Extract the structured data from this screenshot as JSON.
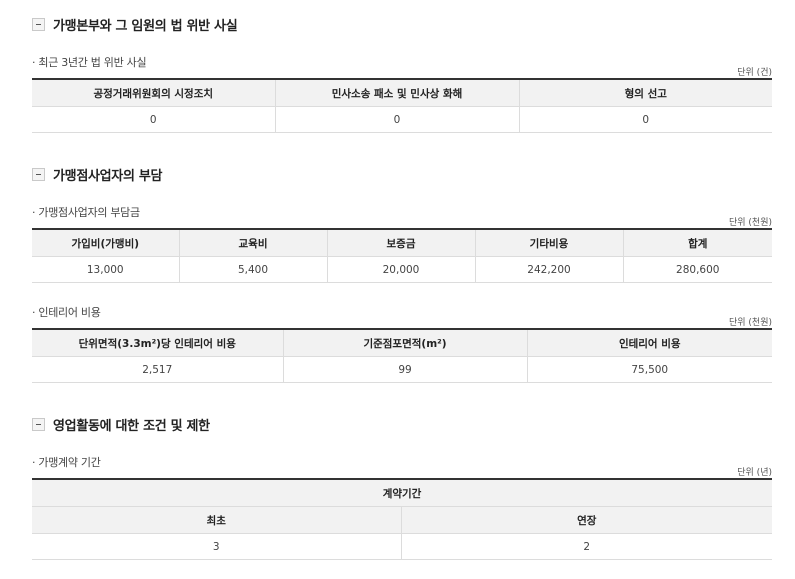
{
  "s1": {
    "title": "가맹본부와 그 임원의 법 위반 사실",
    "subtitle": "· 최근 3년간 법 위반 사실",
    "unit": "단위 (건)",
    "headers": [
      "공정거래위원회의 시정조치",
      "민사소송 패소 및 민사상 화해",
      "형의 선고"
    ],
    "values": [
      "0",
      "0",
      "0"
    ]
  },
  "s2": {
    "title": "가맹점사업자의 부담",
    "fee": {
      "subtitle": "· 가맹점사업자의 부담금",
      "unit": "단위 (천원)",
      "headers": [
        "가입비(가맹비)",
        "교육비",
        "보증금",
        "기타비용",
        "합계"
      ],
      "values": [
        "13,000",
        "5,400",
        "20,000",
        "242,200",
        "280,600"
      ]
    },
    "interior": {
      "subtitle": "· 인테리어 비용",
      "unit": "단위 (천원)",
      "headers": [
        "단위면적(3.3m²)당 인테리어 비용",
        "기준점포면적(m²)",
        "인테리어 비용"
      ],
      "values": [
        "2,517",
        "99",
        "75,500"
      ]
    }
  },
  "s3": {
    "title": "영업활동에 대한 조건 및 제한",
    "subtitle": "· 가맹계약 기간",
    "unit": "단위 (년)",
    "group_header": "계약기간",
    "headers": [
      "최초",
      "연장"
    ],
    "values": [
      "3",
      "2"
    ]
  },
  "colors": {
    "header_bg": "#f2f2f2",
    "rule": "#333333",
    "border": "#dcdcdc"
  },
  "icons": {
    "section_toggle": "minus-box-icon"
  }
}
